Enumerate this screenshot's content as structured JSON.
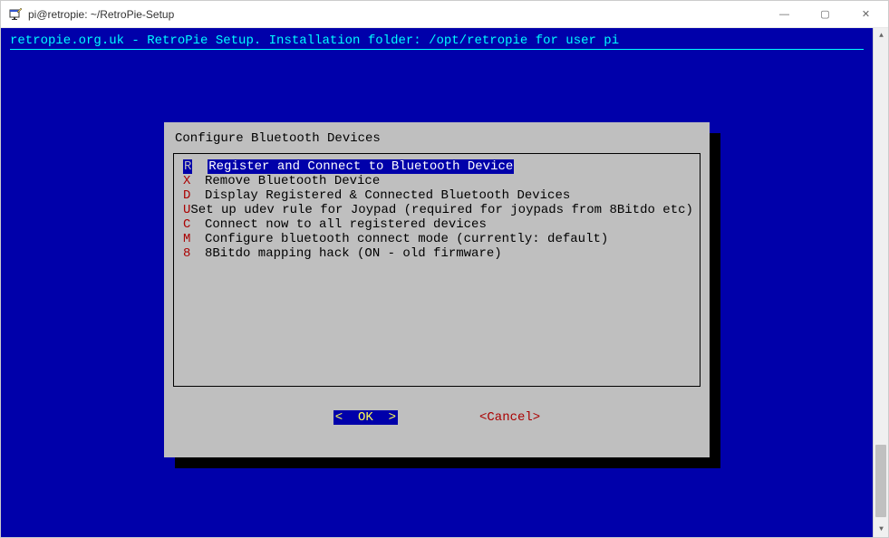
{
  "window": {
    "title": "pi@retropie: ~/RetroPie-Setup",
    "controls": {
      "minimize": "—",
      "maximize": "▢",
      "close": "✕"
    }
  },
  "header": "retropie.org.uk - RetroPie Setup. Installation folder: /opt/retropie for user pi",
  "dialog": {
    "title": "Configure Bluetooth Devices",
    "items": [
      {
        "key": "R",
        "label": "Register and Connect to Bluetooth Device",
        "selected": true
      },
      {
        "key": "X",
        "label": "Remove Bluetooth Device",
        "selected": false
      },
      {
        "key": "D",
        "label": "Display Registered & Connected Bluetooth Devices",
        "selected": false
      },
      {
        "key": "U",
        "label": "Set up udev rule for Joypad (required for joypads from 8Bitdo etc)",
        "selected": false
      },
      {
        "key": "C",
        "label": "Connect now to all registered devices",
        "selected": false
      },
      {
        "key": "M",
        "label": "Configure bluetooth connect mode (currently: default)",
        "selected": false
      },
      {
        "key": "8",
        "label": "8Bitdo mapping hack (ON - old firmware)",
        "selected": false
      }
    ],
    "buttons": {
      "ok": "<  OK  >",
      "cancel": "<Cancel>"
    }
  }
}
